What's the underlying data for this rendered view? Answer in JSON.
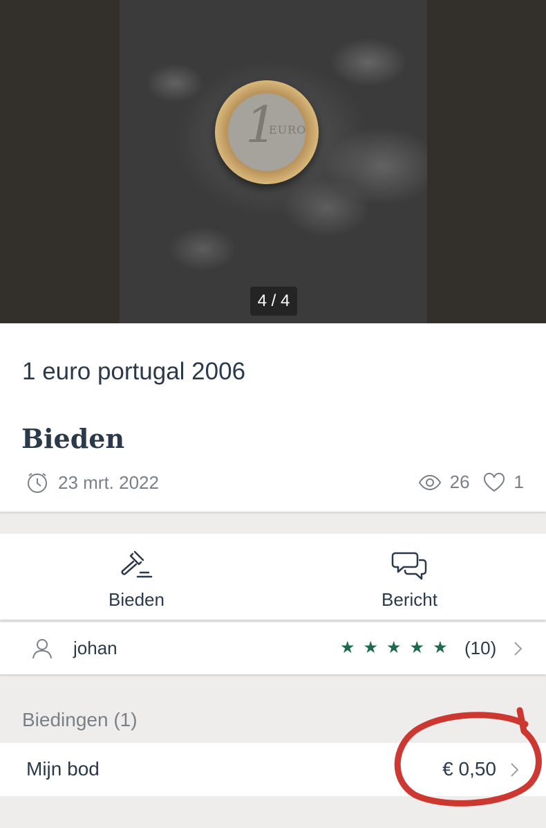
{
  "gallery": {
    "counter": "4 / 4"
  },
  "listing": {
    "title": "1 euro portugal 2006",
    "price_type": "Bieden",
    "date": "23 mrt. 2022",
    "views": "26",
    "favorites": "1"
  },
  "actions": {
    "bid_label": "Bieden",
    "message_label": "Bericht"
  },
  "seller": {
    "name": "johan",
    "stars": "★★★★★",
    "rating_count": "(10)"
  },
  "bids": {
    "section_label": "Biedingen (1)",
    "my_bid_label": "Mijn bod",
    "my_bid_value": "€ 0,50"
  },
  "colors": {
    "rating_green": "#1c6b4c",
    "annotation_red": "#c8231c",
    "text_dark": "#2a3a4a",
    "text_muted": "#7a8088"
  }
}
